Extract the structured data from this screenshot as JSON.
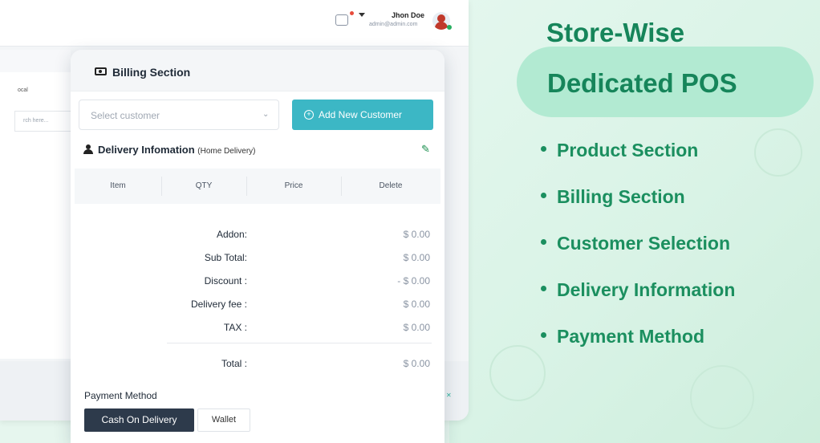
{
  "topbar": {
    "user_name": "Jhon Doe",
    "user_email": "admin@admin.com"
  },
  "background": {
    "local_label": "ocal",
    "search_placeholder": "rch here..."
  },
  "billing": {
    "title": "Billing Section",
    "customer_select_placeholder": "Select customer",
    "add_customer_label": "Add New Customer",
    "delivery_title": "Delivery Infomation",
    "delivery_type": "(Home Delivery)",
    "table_headers": [
      "Item",
      "QTY",
      "Price",
      "Delete"
    ],
    "summary": [
      {
        "label": "Addon:",
        "value": "$ 0.00"
      },
      {
        "label": "Sub Total:",
        "value": "$ 0.00"
      },
      {
        "label": "Discount :",
        "value": "- $ 0.00"
      },
      {
        "label": "Delivery fee :",
        "value": "$ 0.00"
      },
      {
        "label": "TAX :",
        "value": "$ 0.00"
      }
    ],
    "total": {
      "label": "Total :",
      "value": "$ 0.00"
    },
    "payment_title": "Payment Method",
    "payment_options": [
      "Cash On Delivery",
      "Wallet"
    ],
    "selected_payment": "Cash On Delivery"
  },
  "promo": {
    "title_line1": "Store-Wise",
    "title_line2": "Dedicated POS",
    "features": [
      "Product Section",
      "Billing Section",
      "Customer Selection",
      "Delivery Information",
      "Payment Method"
    ]
  },
  "icons": {
    "bill": "money-bill-icon",
    "add": "plus-circle-icon",
    "user": "user-icon",
    "edit": "pencil-icon",
    "chevron": "chevron-down-icon",
    "message": "message-icon"
  },
  "colors": {
    "accent_teal": "#3cb7c5",
    "brand_green": "#16855a",
    "dark_button": "#2d3a4b",
    "promo_pill": "#b2ead2"
  }
}
